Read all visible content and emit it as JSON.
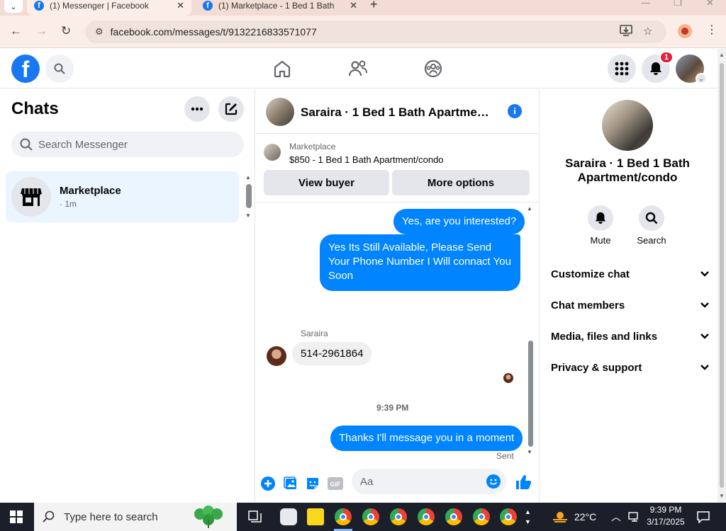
{
  "browser": {
    "tabs": [
      {
        "title": "(1) Messenger | Facebook",
        "active": true
      },
      {
        "title": "(1) Marketplace - 1 Bed 1 Bath",
        "active": false
      }
    ],
    "url": "facebook.com/messages/t/9132216833571077"
  },
  "fbnav": {
    "logo": "f",
    "notifications_count": "1"
  },
  "chats": {
    "title": "Chats",
    "search_placeholder": "Search Messenger",
    "items": [
      {
        "name": "Marketplace",
        "time": "· 1m"
      }
    ]
  },
  "conversation": {
    "title": "Saraira · 1 Bed 1 Bath Apartment/condo",
    "listing_category": "Marketplace",
    "listing_price_title": "$850 - 1 Bed 1 Bath Apartment/condo",
    "view_buyer_label": "View buyer",
    "more_options_label": "More options",
    "messages": [
      {
        "from": "me",
        "text": "Yes, are you interested?"
      },
      {
        "from": "me",
        "text": "Yes Its Still Available, Please Send Your Phone Number I Will connact You Soon"
      },
      {
        "from": "them",
        "sender": "Saraira",
        "text": "514-2961864"
      },
      {
        "from": "me",
        "text": "Thanks I'll message you in a moment"
      }
    ],
    "timestamp": "9:39 PM",
    "sent_status": "Sent",
    "composer_placeholder": "Aa"
  },
  "info_panel": {
    "name": "Saraira · 1 Bed 1 Bath Apartment/condo",
    "actions": [
      {
        "label": "Mute",
        "icon": "bell-icon"
      },
      {
        "label": "Search",
        "icon": "search-icon"
      }
    ],
    "sections": [
      {
        "label": "Customize chat"
      },
      {
        "label": "Chat members"
      },
      {
        "label": "Media, files and links"
      },
      {
        "label": "Privacy & support"
      }
    ]
  },
  "taskbar": {
    "search_placeholder": "Type here to search",
    "weather": "22°C",
    "time": "9:39 PM",
    "date": "3/17/2025"
  },
  "colors": {
    "accent": "#0084ff",
    "brand": "#1877f2",
    "notification": "#e41e3f"
  }
}
